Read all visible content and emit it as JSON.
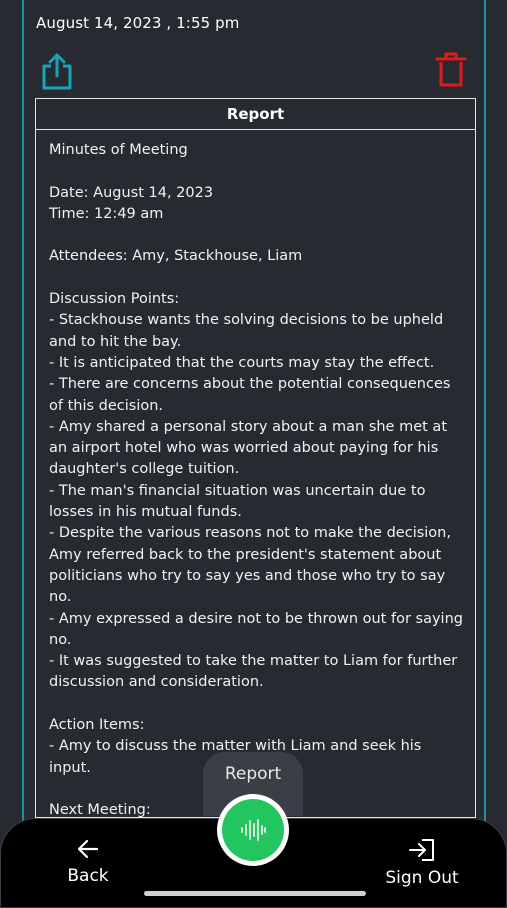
{
  "header": {
    "datetime": "August 14, 2023 , 1:55 pm"
  },
  "report": {
    "title": "Report",
    "content": "Minutes of Meeting\n\nDate: August 14, 2023\nTime: 12:49 am\n\nAttendees: Amy, Stackhouse, Liam\n\nDiscussion Points:\n- Stackhouse wants the solving decisions to be upheld and to hit the bay.\n- It is anticipated that the courts may stay the effect.\n- There are concerns about the potential consequences of this decision.\n- Amy shared a personal story about a man she met at an airport hotel who was worried about paying for his daughter's college tuition.\n- The man's financial situation was uncertain due to losses in his mutual funds.\n- Despite the various reasons not to make the decision, Amy referred back to the president's statement about politicians who try to say yes and those who try to say no.\n- Amy expressed a desire not to be thrown out for saying no.\n- It was suggested to take the matter to Liam for further discussion and consideration.\n\nAction Items:\n- Amy to discuss the matter with Liam and seek his input.\n\nNext Meeting:\nTo be determined based on further discussions with Liam."
  },
  "bottom_nav": {
    "back_label": "Back",
    "signout_label": "Sign Out",
    "record_tooltip": "Report"
  },
  "icons": {
    "share": "share-icon",
    "trash": "trash-icon",
    "back": "arrow-left-icon",
    "signout": "sign-out-icon",
    "record": "audio-wave-icon"
  },
  "colors": {
    "background": "#272a31",
    "accent_teal": "#1f8fa3",
    "delete_red": "#e01b1b",
    "record_green": "#22c55e"
  }
}
